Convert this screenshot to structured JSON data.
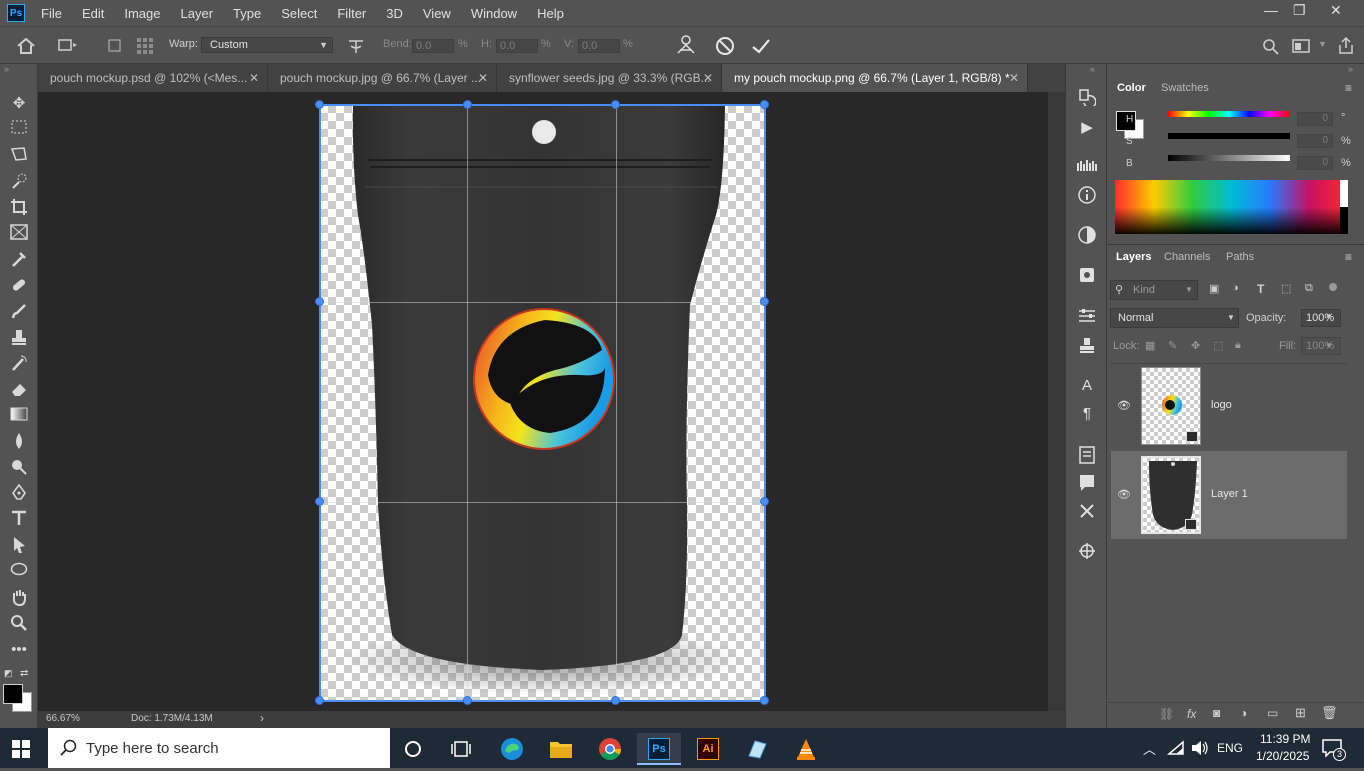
{
  "app": {
    "logo": "Ps",
    "colors": {
      "accent": "#4b8df8",
      "panel": "#535353",
      "canvas": "#282828"
    }
  },
  "menu": {
    "items": [
      "File",
      "Edit",
      "Image",
      "Layer",
      "Type",
      "Select",
      "Filter",
      "3D",
      "View",
      "Window",
      "Help"
    ]
  },
  "window_controls": {
    "minimize": "—",
    "restore": "❐",
    "close": "✕"
  },
  "options": {
    "warp_label": "Warp:",
    "warp_value": "Custom",
    "bend_label": "Bend:",
    "bend_value": "0.0",
    "bend_unit": "%",
    "h_label": "H:",
    "h_value": "0.0",
    "h_unit": "%",
    "v_label": "V:",
    "v_value": "0.0",
    "v_unit": "%"
  },
  "tabs": [
    {
      "label": "pouch mockup.psd @ 102% (<Mes...",
      "close": "✕"
    },
    {
      "label": "pouch mockup.jpg @ 66.7% (Layer ...",
      "close": "✕"
    },
    {
      "label": "synflower seeds.jpg @ 33.3% (RGB...",
      "close": "✕"
    },
    {
      "label": "my pouch mockup.png @ 66.7% (Layer 1, RGB/8) *",
      "close": "✕"
    }
  ],
  "status": {
    "zoom": "66.67%",
    "doc": "Doc: 1.73M/4.13M",
    "arrow": "›"
  },
  "color_panel": {
    "tabs": [
      "Color",
      "Swatches"
    ],
    "h_label": "H",
    "h_value": "0",
    "h_unit": "°",
    "s_label": "S",
    "s_value": "0",
    "s_unit": "%",
    "b_label": "B",
    "b_value": "0",
    "b_unit": "%"
  },
  "layers_panel": {
    "tabs": [
      "Layers",
      "Channels",
      "Paths"
    ],
    "kind_placeholder": "Kind",
    "blend_mode": "Normal",
    "opacity_label": "Opacity:",
    "opacity_value": "100%",
    "lock_label": "Lock:",
    "fill_label": "Fill:",
    "fill_value": "100%",
    "layers": [
      {
        "name": "logo",
        "visible": true,
        "selected": false
      },
      {
        "name": "Layer 1",
        "visible": true,
        "selected": true
      }
    ]
  },
  "taskbar": {
    "search_placeholder": "Type here to search",
    "lang": "ENG",
    "time": "11:39 PM",
    "date": "1/20/2025",
    "notifications": "3",
    "apps": [
      "cortana-icon",
      "task-view-icon",
      "edge-icon",
      "file-explorer-icon",
      "chrome-icon",
      "photoshop-icon",
      "illustrator-icon",
      "app-icon",
      "vlc-icon"
    ]
  }
}
